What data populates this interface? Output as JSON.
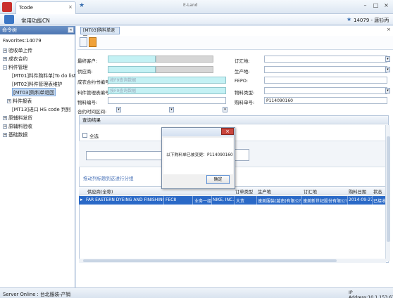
{
  "window": {
    "tab_title": "Tcode",
    "tab_close": "×",
    "title": "E-Land",
    "buttons": {
      "minimize": "–",
      "maximize": "□",
      "close": "×"
    }
  },
  "menu_bar": {
    "title": "常用功能CN",
    "user": "14079 - 唐钐丙",
    "star": "★"
  },
  "sidebar": {
    "header": "命令树",
    "collapse": "«",
    "items": [
      {
        "label": "Favorites:14079"
      },
      {
        "label": "验收单上传",
        "expander": "+"
      },
      {
        "label": "成衣合约",
        "expander": "+"
      },
      {
        "label": "料件管理",
        "expander": "−"
      },
      {
        "label": "[MT01]料件购料单[To do list]"
      },
      {
        "label": "[MT02]料件管理表维护"
      },
      {
        "label": "[MT03]购料单退回",
        "selected": true
      },
      {
        "label": "料件报表",
        "expander": "+"
      },
      {
        "label": "[MT13]进口 HS code 判别"
      },
      {
        "label": "原辅料发货",
        "expander": "+"
      },
      {
        "label": "原辅料验收",
        "expander": "+"
      },
      {
        "label": "基础数据",
        "expander": "+"
      }
    ]
  },
  "document": {
    "tab": "[MT03]购料单退回",
    "close": "×"
  },
  "form": {
    "labels": {
      "vendor": "最终客户:",
      "supplier": "供应商:",
      "contract_no": "成衣合约书编号:",
      "mgmt_no": "料件管理表编号:",
      "material_no": "物料编号:",
      "contract_date": "合约时间区间:",
      "issue_place": "订汇地:",
      "production_place": "生产地:",
      "fepo": "FEPO:",
      "material_type": "物料类型:",
      "purchase_no": "购料单号:"
    },
    "values": {
      "contract_no_placeholder": "按F9查询数据",
      "mgmt_no_placeholder": "按F9查询数据",
      "purchase_no": "P114090160"
    }
  },
  "results": {
    "header": "查询结果",
    "select_all": "全选",
    "group_hint": "拖动列标题到这进行分组",
    "columns": [
      "供应商(全称)",
      "订单类型",
      "生产地",
      "订汇地",
      "购料日期",
      "状态"
    ],
    "rows": [
      {
        "supplier": "FAR EASTERN DYEING AND FINISHING LT",
        "code": "FEC8",
        "dept": "业务一组",
        "brand": "NIKE, INC.",
        "order_type": "大货",
        "production": "速美服装(越南)有限公司",
        "issue": "速美新世纪股份有限公司",
        "date": "2014-09-27",
        "status": "已接收"
      }
    ]
  },
  "dialog": {
    "close": "×",
    "message": "以下购料单已被变更：P114090160",
    "ok": "确定"
  },
  "statusbar": {
    "left": "Server Online : 台北服装-产销",
    "right": "IP Address:10.1.153.61"
  }
}
